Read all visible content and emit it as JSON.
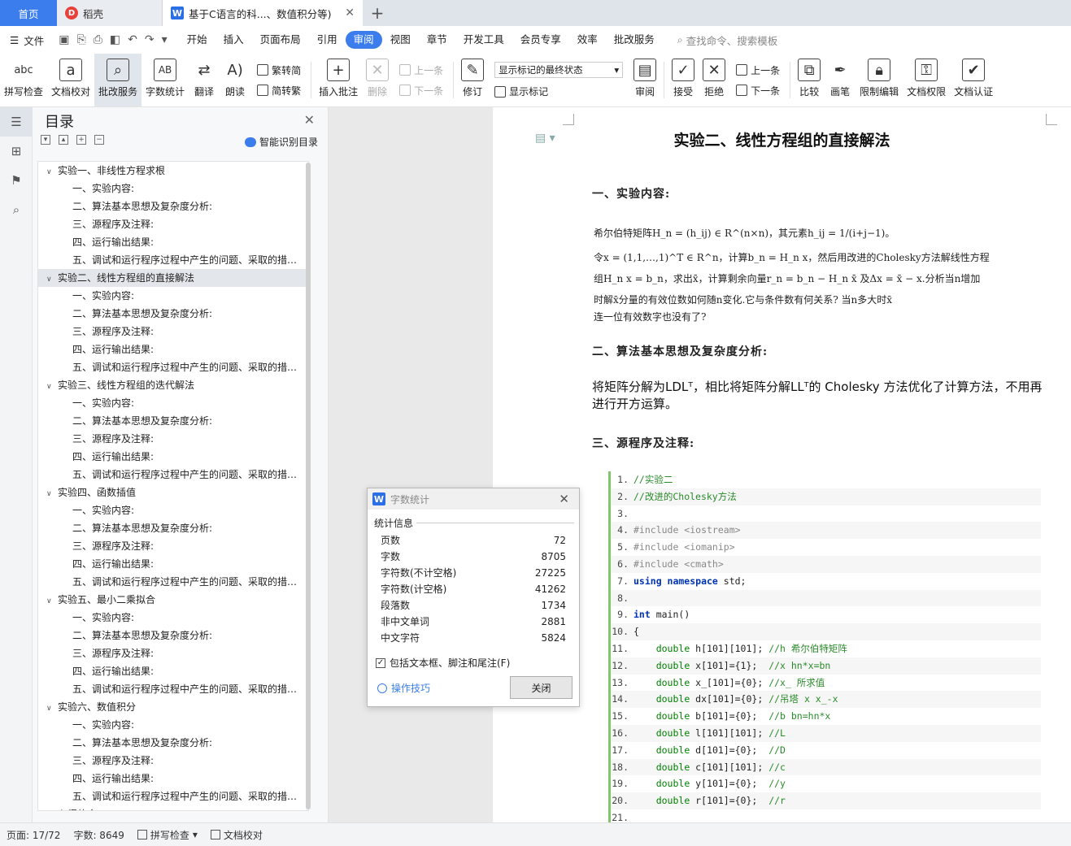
{
  "tabs": {
    "home": "首页",
    "daoke": "稻壳",
    "doc": "基于C语言的科...、数值积分等)",
    "daoke_logo": "D",
    "doc_logo": "W"
  },
  "menu": {
    "file": "文件",
    "items": [
      "开始",
      "插入",
      "页面布局",
      "引用",
      "审阅",
      "视图",
      "章节",
      "开发工具",
      "会员专享",
      "效率",
      "批改服务"
    ],
    "active": "审阅",
    "search": "查找命令、搜索模板"
  },
  "ribbon": {
    "spell": "拼写检查",
    "proof": "文档校对",
    "grade": "批改服务",
    "wordcount": "字数统计",
    "translate": "翻译",
    "read": "朗读",
    "trad_to_simp": "繁转简",
    "simp_to_trad": "简转繁",
    "insert_comment": "插入批注",
    "delete": "删除",
    "prev": "上一条",
    "next": "下一条",
    "track": "修订",
    "markup_select": "显示标记的最终状态",
    "show_markup": "显示标记",
    "review": "审阅",
    "accept": "接受",
    "reject": "拒绝",
    "prev2": "上一条",
    "next2": "下一条",
    "compare": "比较",
    "pen": "画笔",
    "restrict": "限制编辑",
    "perm": "文档权限",
    "cert": "文档认证"
  },
  "toc": {
    "title": "目录",
    "smart": "智能识别目录",
    "items": [
      {
        "t": "实验一、非线性方程求根",
        "l": 1
      },
      {
        "t": "一、实验内容:",
        "l": 2
      },
      {
        "t": "二、算法基本思想及复杂度分析:",
        "l": 2
      },
      {
        "t": "三、源程序及注释:",
        "l": 2
      },
      {
        "t": "四、运行输出结果:",
        "l": 2
      },
      {
        "t": "五、调试和运行程序过程中产生的问题、采取的措施…",
        "l": 2
      },
      {
        "t": "实验二、线性方程组的直接解法",
        "l": 1,
        "sel": true
      },
      {
        "t": "一、实验内容:",
        "l": 2
      },
      {
        "t": "二、算法基本思想及复杂度分析:",
        "l": 2
      },
      {
        "t": "三、源程序及注释:",
        "l": 2
      },
      {
        "t": "四、运行输出结果:",
        "l": 2
      },
      {
        "t": "五、调试和运行程序过程中产生的问题、采取的措施…",
        "l": 2
      },
      {
        "t": "实验三、线性方程组的迭代解法",
        "l": 1
      },
      {
        "t": "一、实验内容:",
        "l": 2
      },
      {
        "t": "二、算法基本思想及复杂度分析:",
        "l": 2
      },
      {
        "t": "三、源程序及注释:",
        "l": 2
      },
      {
        "t": "四、运行输出结果:",
        "l": 2
      },
      {
        "t": "五、调试和运行程序过程中产生的问题、采取的措施…",
        "l": 2
      },
      {
        "t": "实验四、函数插值",
        "l": 1
      },
      {
        "t": "一、实验内容:",
        "l": 2
      },
      {
        "t": "二、算法基本思想及复杂度分析:",
        "l": 2
      },
      {
        "t": "三、源程序及注释:",
        "l": 2
      },
      {
        "t": "四、运行输出结果:",
        "l": 2
      },
      {
        "t": "五、调试和运行程序过程中产生的问题、采取的措施…",
        "l": 2
      },
      {
        "t": "实验五、最小二乘拟合",
        "l": 1
      },
      {
        "t": "一、实验内容:",
        "l": 2
      },
      {
        "t": "二、算法基本思想及复杂度分析:",
        "l": 2
      },
      {
        "t": "三、源程序及注释:",
        "l": 2
      },
      {
        "t": "四、运行输出结果:",
        "l": 2
      },
      {
        "t": "五、调试和运行程序过程中产生的问题、采取的措施…",
        "l": 2
      },
      {
        "t": "实验六、数值积分",
        "l": 1
      },
      {
        "t": "一、实验内容:",
        "l": 2
      },
      {
        "t": "二、算法基本思想及复杂度分析:",
        "l": 2
      },
      {
        "t": "三、源程序及注释:",
        "l": 2
      },
      {
        "t": "四、运行输出结果:",
        "l": 2
      },
      {
        "t": "五、调试和运行程序过程中产生的问题、采取的措施…",
        "l": 2
      },
      {
        "t": "心得体会",
        "l": 1
      }
    ]
  },
  "doc": {
    "title": "实验二、线性方程组的直接解法",
    "h_content": "一、实验内容:",
    "math1": "希尔伯特矩阵H_n = (h_ij) ∈ R^(n×n)，其元素h_ij = 1/(i+j−1)。",
    "math2": "令x = (1,1,…,1)^T ∈ R^n，计算b_n = H_n x，然后用改进的Cholesky方法解线性方程",
    "math3": "组H_n x = b_n，求出x̄，计算剩余向量r_n = b_n − H_n x̄ 及Δx = x̄ − x.分析当n增加",
    "math4": "时解x̄分量的有效位数如何随n变化.它与条件数有何关系? 当n多大时x̄",
    "math5": "连一位有效数字也没有了?",
    "h_algo": "二、算法基本思想及复杂度分析:",
    "para": "将矩阵分解为LDLᵀ，相比将矩阵分解LLᵀ的 Cholesky 方法优化了计算方法，不用再进行开方运算。",
    "h_src": "三、源程序及注释:",
    "code": [
      {
        "n": "1.",
        "html": "<span class=\"cm\">//实验二</span>"
      },
      {
        "n": "2.",
        "html": "<span class=\"cm\">//改进的Cholesky方法</span>"
      },
      {
        "n": "3.",
        "html": ""
      },
      {
        "n": "4.",
        "html": "<span class=\"pp\">#include &lt;iostream&gt;</span>"
      },
      {
        "n": "5.",
        "html": "<span class=\"pp\">#include &lt;iomanip&gt;</span>"
      },
      {
        "n": "6.",
        "html": "<span class=\"pp\">#include &lt;cmath&gt;</span>"
      },
      {
        "n": "7.",
        "html": "<span class=\"kw\">using namespace</span> std;"
      },
      {
        "n": "8.",
        "html": ""
      },
      {
        "n": "9.",
        "html": "<span class=\"kw\">int</span> main()"
      },
      {
        "n": "10.",
        "html": "{"
      },
      {
        "n": "11.",
        "html": "    <span class=\"ty\">double</span> h[101][101]; <span class=\"cm\">//h 希尔伯特矩阵</span>"
      },
      {
        "n": "12.",
        "html": "    <span class=\"ty\">double</span> x[101]={1};  <span class=\"cm\">//x hn*x=bn</span>"
      },
      {
        "n": "13.",
        "html": "    <span class=\"ty\">double</span> x_[101]={0}; <span class=\"cm\">//x_ 所求值</span>"
      },
      {
        "n": "14.",
        "html": "    <span class=\"ty\">double</span> dx[101]={0}; <span class=\"cm\">//吊塔 x x_-x</span>"
      },
      {
        "n": "15.",
        "html": "    <span class=\"ty\">double</span> b[101]={0};  <span class=\"cm\">//b bn=hn*x</span>"
      },
      {
        "n": "16.",
        "html": "    <span class=\"ty\">double</span> l[101][101]; <span class=\"cm\">//L</span>"
      },
      {
        "n": "17.",
        "html": "    <span class=\"ty\">double</span> d[101]={0};  <span class=\"cm\">//D</span>"
      },
      {
        "n": "18.",
        "html": "    <span class=\"ty\">double</span> c[101][101]; <span class=\"cm\">//c</span>"
      },
      {
        "n": "19.",
        "html": "    <span class=\"ty\">double</span> y[101]={0};  <span class=\"cm\">//y</span>"
      },
      {
        "n": "20.",
        "html": "    <span class=\"ty\">double</span> r[101]={0};  <span class=\"cm\">//r</span>"
      },
      {
        "n": "21.",
        "html": ""
      }
    ]
  },
  "dialog": {
    "title": "字数统计",
    "section": "统计信息",
    "rows": [
      {
        "k": "页数",
        "v": "72"
      },
      {
        "k": "字数",
        "v": "8705"
      },
      {
        "k": "字符数(不计空格)",
        "v": "27225"
      },
      {
        "k": "字符数(计空格)",
        "v": "41262"
      },
      {
        "k": "段落数",
        "v": "1734"
      },
      {
        "k": "非中文单词",
        "v": "2881"
      },
      {
        "k": "中文字符",
        "v": "5824"
      }
    ],
    "include": "包括文本框、脚注和尾注(F)",
    "tips": "操作技巧",
    "close": "关闭"
  },
  "status": {
    "page": "页面: 17/72",
    "words": "字数: 8649",
    "spell": "拼写检查",
    "proof": "文档校对"
  }
}
